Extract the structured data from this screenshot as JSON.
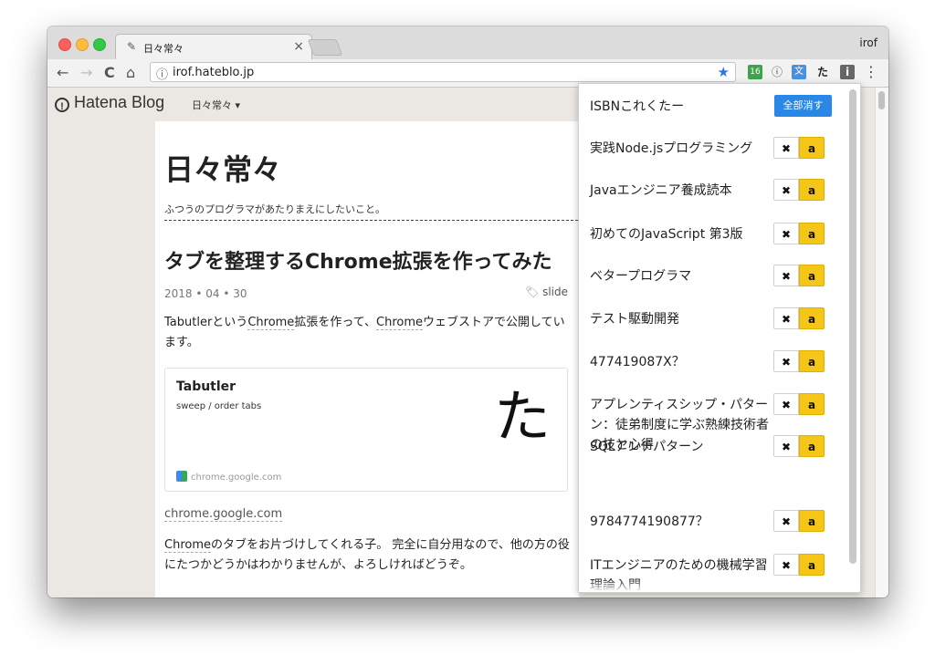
{
  "browser": {
    "tab_title": "日々常々",
    "tab_close": "×",
    "profile": "irof",
    "url": "irof.hateblo.jp",
    "nav": {
      "back": "←",
      "forward": "→",
      "reload": "C",
      "home": "⌂"
    },
    "extensions": [
      {
        "name": "calendar-extension",
        "label": "16",
        "color": "#3fa34d"
      },
      {
        "name": "info-extension",
        "label": "ⓘ",
        "color": "#555555"
      },
      {
        "name": "translate-extension",
        "label": "文",
        "color": "#4a90e2"
      },
      {
        "name": "tabutler-extension",
        "label": "た",
        "color": "#222222"
      },
      {
        "name": "isbn-extension",
        "label": "i",
        "color": "#777777"
      }
    ],
    "menu": "⋮"
  },
  "hatena": {
    "logo": "Hatena Blog",
    "blog_select": "日々常々 ▾",
    "right_partial": "a"
  },
  "blog": {
    "title": "日々常々",
    "description": "ふつうのプログラマがあたりまえにしたいこと。",
    "entry_title": "タブを整理するChrome拡張を作ってみた",
    "date": "2018 • 04 • 30",
    "tag": "slide",
    "para1_a": "Tabutlerという",
    "para1_link": "Chrome",
    "para1_b": "拡張を作って、",
    "para1_link2": "Chrome",
    "para1_c": "ウェブストアで公開しています。",
    "card": {
      "title": "Tabutler",
      "subtitle": "sweep / order tabs",
      "handwriting": "た",
      "site": "chrome.google.com"
    },
    "source_link": "chrome.google.com",
    "para2_link": "Chrome",
    "para2": "のタブをお片づけしてくれる子。 完全に自分用なので、他の方の役にたつかどうかはわかりませんが、よろしければどうぞ。"
  },
  "popup": {
    "header": "ISBNこれくたー",
    "clear_all": "全部消す",
    "delete_label": "✖",
    "amazon_label": "a",
    "books": [
      "実践Node.jsプログラミング",
      "Javaエンジニア養成読本",
      "初めてのJavaScript 第3版",
      "ベタープログラマ",
      "テスト駆動開発",
      "477419087X？",
      "アプレンティスシップ・パターン：徒弟制度に学ぶ熟練技術者の技と心得",
      "SQLアンチパターン",
      "9784774190877？",
      "ITエンジニアのための機械学習理論入門"
    ]
  }
}
